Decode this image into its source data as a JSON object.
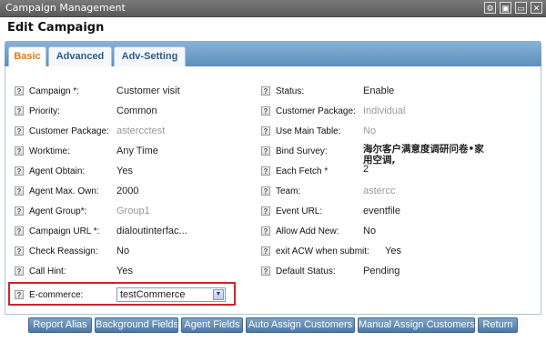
{
  "window": {
    "title": "Campaign Management",
    "buttons": [
      "settings-icon",
      "maximize-icon",
      "restore-icon",
      "close-icon"
    ]
  },
  "header": {
    "title": "Edit Campaign"
  },
  "tabs": [
    {
      "label": "Basic",
      "active": true
    },
    {
      "label": "Advanced",
      "active": false
    },
    {
      "label": "Adv-Setting",
      "active": false
    }
  ],
  "left_fields": [
    {
      "label": "Campaign *:",
      "value": "Customer visit",
      "muted": false
    },
    {
      "label": "Priority:",
      "value": "Common",
      "muted": false
    },
    {
      "label": "Customer Package:",
      "value": "astercctest",
      "muted": true
    },
    {
      "label": "Worktime:",
      "value": "Any Time",
      "muted": false
    },
    {
      "label": "Agent Obtain:",
      "value": "Yes",
      "muted": false
    },
    {
      "label": "Agent Max. Own:",
      "value": "2000",
      "muted": false
    },
    {
      "label": "Agent Group*:",
      "value": "Group1",
      "muted": true
    },
    {
      "label": "Campaign URL *:",
      "value": "dialoutinterfac...",
      "muted": false
    },
    {
      "label": "Check Reassign:",
      "value": "No",
      "muted": false
    },
    {
      "label": "Call Hint:",
      "value": "Yes",
      "muted": false
    }
  ],
  "right_fields": [
    {
      "label": "Status:",
      "value": "Enable",
      "muted": false
    },
    {
      "label": "Customer Package:",
      "value": "Individual",
      "muted": true
    },
    {
      "label": "Use Main Table:",
      "value": "No",
      "muted": true
    },
    {
      "label": "Bind Survey:",
      "value": "海尔客户满意度调研问卷•家用空调,",
      "muted": false
    },
    {
      "label": "Each Fetch *",
      "value": "2",
      "muted": false
    },
    {
      "label": "Team:",
      "value": "astercc",
      "muted": true
    },
    {
      "label": "Event URL:",
      "value": "eventfile",
      "muted": false
    },
    {
      "label": "Allow Add New:",
      "value": "No",
      "muted": false
    },
    {
      "label": "exit ACW when submit:",
      "value": "Yes",
      "muted": false
    },
    {
      "label": "Default Status:",
      "value": "Pending",
      "muted": false
    }
  ],
  "ecommerce": {
    "label": "E-commerce:",
    "selected": "testCommerce"
  },
  "buttons": [
    "Report Alias",
    "Background Fields",
    "Agent Fields",
    "Auto Assign Customers",
    "Manual Assign Customers",
    "Return"
  ],
  "colors": {
    "accent_tab": "#e07b12",
    "tab_text": "#2d5a8a",
    "highlight_border": "#d6202a",
    "button_bg": "#5b85b0"
  }
}
